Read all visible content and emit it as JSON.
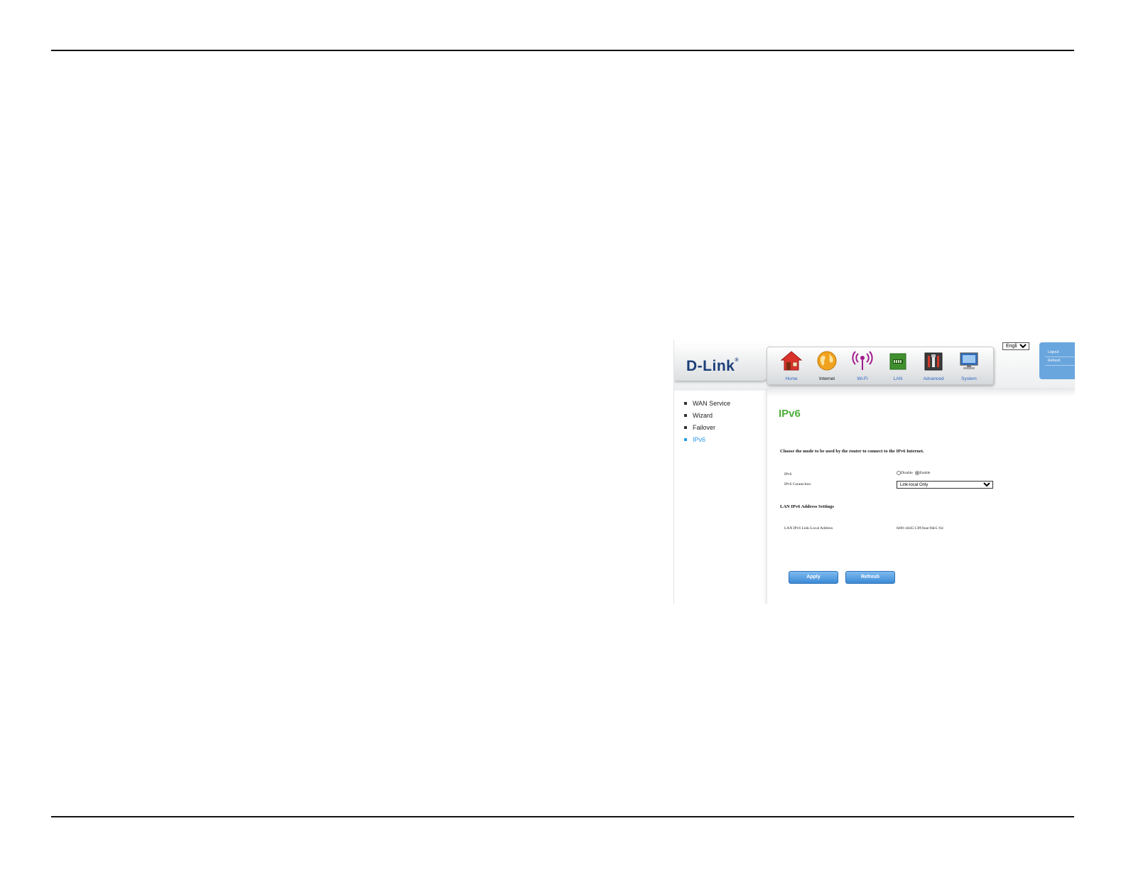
{
  "brand": {
    "logo": "D-Link"
  },
  "nav": {
    "items": [
      {
        "label": "Home",
        "icon": "house-icon"
      },
      {
        "label": "Internet",
        "icon": "globe-icon"
      },
      {
        "label": "Wi-Fi",
        "icon": "wireless-icon"
      },
      {
        "label": "LAN",
        "icon": "network-card-icon"
      },
      {
        "label": "Advanced",
        "icon": "tools-icon"
      },
      {
        "label": "System",
        "icon": "monitor-icon"
      }
    ],
    "active": "Internet"
  },
  "language": {
    "selected": "English"
  },
  "side_tab": {
    "logout": "Logout",
    "refresh": "Refresh"
  },
  "sidebar": {
    "items": [
      {
        "label": "WAN Service"
      },
      {
        "label": "Wizard"
      },
      {
        "label": "Failover"
      },
      {
        "label": "IPv6"
      }
    ],
    "active": "IPv6"
  },
  "content": {
    "title": "IPv6",
    "intro": "Choose the mode to be used by the router to connect to the IPv6 Internet.",
    "ipv6": {
      "label": "IPv6",
      "options": [
        "Disable",
        "Enable"
      ],
      "selected": "Enable"
    },
    "connection": {
      "label": "IPv6 Connection",
      "selected": "Link-local Only"
    },
    "lan_section_title": "LAN IPv6 Address Settings",
    "link_local": {
      "label": "LAN IPv6 Link-Local Address",
      "value": "fe80::d445:13ff:feae:9de5 /64"
    },
    "buttons": {
      "apply": "Apply",
      "refresh": "Refresh"
    }
  },
  "colors": {
    "title_green": "#4fae3b",
    "link_blue": "#2a63c4",
    "active_blue": "#2a9be8",
    "button_blue": "#3c8ad6",
    "side_tab_blue": "#6aa6de",
    "logo_navy": "#1d3f7a"
  }
}
